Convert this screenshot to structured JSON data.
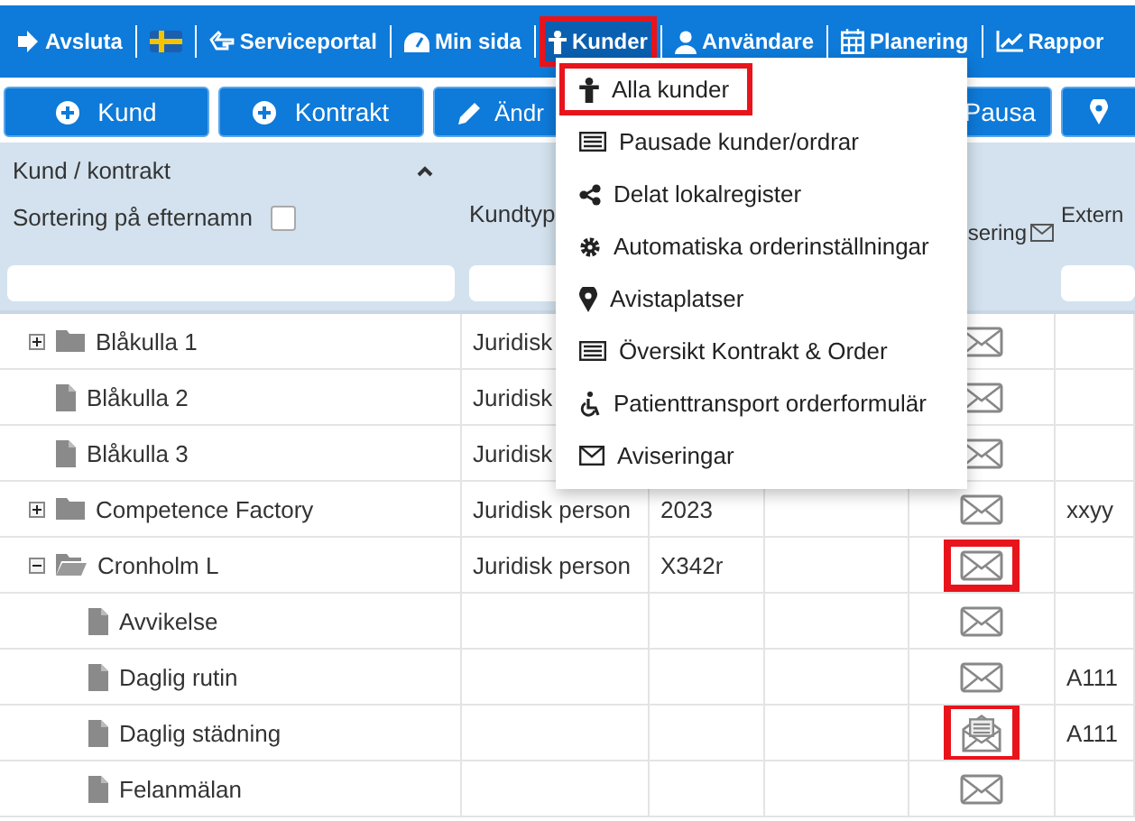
{
  "nav": [
    {
      "label": "Avsluta",
      "highlighted": false
    },
    {
      "highlighted": false
    },
    {
      "label": "Serviceportal",
      "highlighted": false
    },
    {
      "label": "Min sida",
      "highlighted": false
    },
    {
      "label": "Kunder",
      "highlighted": true
    },
    {
      "label": "Användare",
      "highlighted": false
    },
    {
      "label": "Planering",
      "highlighted": false
    },
    {
      "label": "Rappor",
      "highlighted": false
    }
  ],
  "toolbar": [
    {
      "label": "Kund"
    },
    {
      "label": "Kontrakt"
    },
    {
      "label": "Ändr"
    },
    {
      "label": "Pausa"
    }
  ],
  "table": {
    "columns": [
      {
        "label": "Kund / kontrakt",
        "filter": true
      },
      {
        "label": "Kundtyp",
        "filter": true
      },
      {},
      {},
      {
        "label": "sering",
        "mail_icon": true
      },
      {
        "label": "Extern",
        "filter": true
      }
    ],
    "sort_option": {
      "label": "Sortering på efternamn",
      "checked": false
    },
    "rows": [
      {
        "kind": "folder",
        "name": "Blåkulla 1",
        "expanded": false,
        "type": "Juridisk",
        "mail_opened": false,
        "mail_highlighted": false
      },
      {
        "kind": "file",
        "name": "Blåkulla 2",
        "type": "Juridisk",
        "mail_opened": false,
        "mail_highlighted": false
      },
      {
        "kind": "file",
        "name": "Blåkulla 3",
        "type": "Juridisk",
        "mail_opened": false,
        "mail_highlighted": false
      },
      {
        "kind": "folder",
        "name": "Competence Factory",
        "expanded": false,
        "type": "Juridisk person",
        "number": "2023",
        "mail_opened": false,
        "mail_highlighted": false,
        "extern": "xxyy"
      },
      {
        "kind": "folder",
        "name": "Cronholm L",
        "expanded": true,
        "type": "Juridisk person",
        "number": "X342r",
        "mail_opened": false,
        "mail_highlighted": true,
        "children": [
          {
            "kind": "file",
            "name": "Avvikelse",
            "mail_opened": false,
            "mail_highlighted": false
          },
          {
            "kind": "file",
            "name": "Daglig rutin",
            "mail_opened": false,
            "mail_highlighted": false,
            "extern": "A111"
          },
          {
            "kind": "file",
            "name": "Daglig städning",
            "mail_opened": true,
            "mail_highlighted": true,
            "extern": "A111"
          },
          {
            "kind": "file",
            "name": "Felanmälan",
            "mail_opened": false,
            "mail_highlighted": false
          }
        ]
      }
    ]
  },
  "menu": [
    {
      "label": "Alla kunder",
      "highlighted": true
    },
    {
      "label": "Pausade kunder/ordrar",
      "highlighted": false
    },
    {
      "label": "Delat lokalregister",
      "highlighted": false
    },
    {
      "label": "Automatiska orderinställningar",
      "highlighted": false
    },
    {
      "label": "Avistaplatser",
      "highlighted": false
    },
    {
      "label": "Översikt Kontrakt & Order",
      "highlighted": false
    },
    {
      "label": "Patienttransport orderformulär",
      "highlighted": false
    },
    {
      "label": "Aviseringar",
      "highlighted": false
    }
  ]
}
